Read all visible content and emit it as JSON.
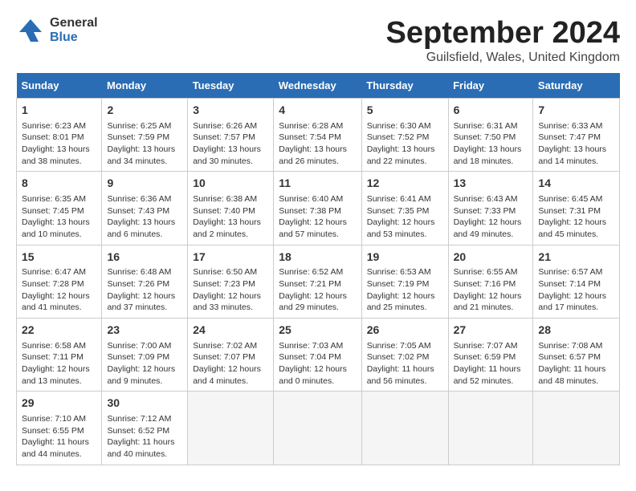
{
  "logo": {
    "general": "General",
    "blue": "Blue"
  },
  "title": "September 2024",
  "location": "Guilsfield, Wales, United Kingdom",
  "days_of_week": [
    "Sunday",
    "Monday",
    "Tuesday",
    "Wednesday",
    "Thursday",
    "Friday",
    "Saturday"
  ],
  "weeks": [
    [
      {
        "day": "1",
        "info": "Sunrise: 6:23 AM\nSunset: 8:01 PM\nDaylight: 13 hours\nand 38 minutes."
      },
      {
        "day": "2",
        "info": "Sunrise: 6:25 AM\nSunset: 7:59 PM\nDaylight: 13 hours\nand 34 minutes."
      },
      {
        "day": "3",
        "info": "Sunrise: 6:26 AM\nSunset: 7:57 PM\nDaylight: 13 hours\nand 30 minutes."
      },
      {
        "day": "4",
        "info": "Sunrise: 6:28 AM\nSunset: 7:54 PM\nDaylight: 13 hours\nand 26 minutes."
      },
      {
        "day": "5",
        "info": "Sunrise: 6:30 AM\nSunset: 7:52 PM\nDaylight: 13 hours\nand 22 minutes."
      },
      {
        "day": "6",
        "info": "Sunrise: 6:31 AM\nSunset: 7:50 PM\nDaylight: 13 hours\nand 18 minutes."
      },
      {
        "day": "7",
        "info": "Sunrise: 6:33 AM\nSunset: 7:47 PM\nDaylight: 13 hours\nand 14 minutes."
      }
    ],
    [
      {
        "day": "8",
        "info": "Sunrise: 6:35 AM\nSunset: 7:45 PM\nDaylight: 13 hours\nand 10 minutes."
      },
      {
        "day": "9",
        "info": "Sunrise: 6:36 AM\nSunset: 7:43 PM\nDaylight: 13 hours\nand 6 minutes."
      },
      {
        "day": "10",
        "info": "Sunrise: 6:38 AM\nSunset: 7:40 PM\nDaylight: 13 hours\nand 2 minutes."
      },
      {
        "day": "11",
        "info": "Sunrise: 6:40 AM\nSunset: 7:38 PM\nDaylight: 12 hours\nand 57 minutes."
      },
      {
        "day": "12",
        "info": "Sunrise: 6:41 AM\nSunset: 7:35 PM\nDaylight: 12 hours\nand 53 minutes."
      },
      {
        "day": "13",
        "info": "Sunrise: 6:43 AM\nSunset: 7:33 PM\nDaylight: 12 hours\nand 49 minutes."
      },
      {
        "day": "14",
        "info": "Sunrise: 6:45 AM\nSunset: 7:31 PM\nDaylight: 12 hours\nand 45 minutes."
      }
    ],
    [
      {
        "day": "15",
        "info": "Sunrise: 6:47 AM\nSunset: 7:28 PM\nDaylight: 12 hours\nand 41 minutes."
      },
      {
        "day": "16",
        "info": "Sunrise: 6:48 AM\nSunset: 7:26 PM\nDaylight: 12 hours\nand 37 minutes."
      },
      {
        "day": "17",
        "info": "Sunrise: 6:50 AM\nSunset: 7:23 PM\nDaylight: 12 hours\nand 33 minutes."
      },
      {
        "day": "18",
        "info": "Sunrise: 6:52 AM\nSunset: 7:21 PM\nDaylight: 12 hours\nand 29 minutes."
      },
      {
        "day": "19",
        "info": "Sunrise: 6:53 AM\nSunset: 7:19 PM\nDaylight: 12 hours\nand 25 minutes."
      },
      {
        "day": "20",
        "info": "Sunrise: 6:55 AM\nSunset: 7:16 PM\nDaylight: 12 hours\nand 21 minutes."
      },
      {
        "day": "21",
        "info": "Sunrise: 6:57 AM\nSunset: 7:14 PM\nDaylight: 12 hours\nand 17 minutes."
      }
    ],
    [
      {
        "day": "22",
        "info": "Sunrise: 6:58 AM\nSunset: 7:11 PM\nDaylight: 12 hours\nand 13 minutes."
      },
      {
        "day": "23",
        "info": "Sunrise: 7:00 AM\nSunset: 7:09 PM\nDaylight: 12 hours\nand 9 minutes."
      },
      {
        "day": "24",
        "info": "Sunrise: 7:02 AM\nSunset: 7:07 PM\nDaylight: 12 hours\nand 4 minutes."
      },
      {
        "day": "25",
        "info": "Sunrise: 7:03 AM\nSunset: 7:04 PM\nDaylight: 12 hours\nand 0 minutes."
      },
      {
        "day": "26",
        "info": "Sunrise: 7:05 AM\nSunset: 7:02 PM\nDaylight: 11 hours\nand 56 minutes."
      },
      {
        "day": "27",
        "info": "Sunrise: 7:07 AM\nSunset: 6:59 PM\nDaylight: 11 hours\nand 52 minutes."
      },
      {
        "day": "28",
        "info": "Sunrise: 7:08 AM\nSunset: 6:57 PM\nDaylight: 11 hours\nand 48 minutes."
      }
    ],
    [
      {
        "day": "29",
        "info": "Sunrise: 7:10 AM\nSunset: 6:55 PM\nDaylight: 11 hours\nand 44 minutes."
      },
      {
        "day": "30",
        "info": "Sunrise: 7:12 AM\nSunset: 6:52 PM\nDaylight: 11 hours\nand 40 minutes."
      },
      {
        "day": "",
        "info": ""
      },
      {
        "day": "",
        "info": ""
      },
      {
        "day": "",
        "info": ""
      },
      {
        "day": "",
        "info": ""
      },
      {
        "day": "",
        "info": ""
      }
    ]
  ]
}
